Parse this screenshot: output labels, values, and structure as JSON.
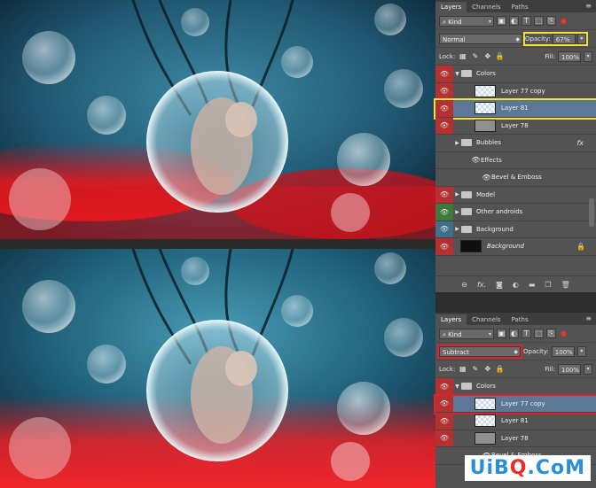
{
  "panel_top": {
    "tabs": [
      "Layers",
      "Channels",
      "Paths"
    ],
    "kind_label": "Kind",
    "blend_mode": "Normal",
    "opacity_label": "Opacity:",
    "opacity_value": "67%",
    "lock_label": "Lock:",
    "fill_label": "Fill:",
    "fill_value": "100%",
    "layers": [
      {
        "name": "Colors",
        "type": "group-open",
        "eye": "red"
      },
      {
        "name": "Layer 77 copy",
        "type": "layer",
        "eye": "red"
      },
      {
        "name": "Layer 81",
        "type": "layer",
        "eye": "red",
        "selected": true
      },
      {
        "name": "Layer 78",
        "type": "layer",
        "eye": "red"
      },
      {
        "name": "Bubbles",
        "type": "group",
        "eye": "none"
      },
      {
        "name": "Effects",
        "type": "effects",
        "eye": "none"
      },
      {
        "name": "Bevel & Emboss",
        "type": "effect",
        "eye": "none"
      },
      {
        "name": "Model",
        "type": "group",
        "eye": "red"
      },
      {
        "name": "Other androids",
        "type": "group",
        "eye": "green"
      },
      {
        "name": "Background",
        "type": "group",
        "eye": "blue"
      },
      {
        "name": "Background",
        "type": "bg",
        "eye": "red"
      }
    ]
  },
  "panel_bottom": {
    "tabs": [
      "Layers",
      "Channels",
      "Paths"
    ],
    "kind_label": "Kind",
    "blend_mode": "Subtract",
    "opacity_label": "Opacity:",
    "opacity_value": "100%",
    "lock_label": "Lock:",
    "fill_label": "Fill:",
    "fill_value": "100%",
    "layers": [
      {
        "name": "Colors",
        "type": "group-open",
        "eye": "red"
      },
      {
        "name": "Layer 77 copy",
        "type": "layer",
        "eye": "red",
        "selected": true
      },
      {
        "name": "Layer 81",
        "type": "layer",
        "eye": "red"
      },
      {
        "name": "Layer 78",
        "type": "layer",
        "eye": "red"
      },
      {
        "name": "Bevel & Emboss",
        "type": "effect",
        "eye": "none"
      }
    ]
  },
  "watermark": {
    "part1": "UiB",
    "part2": "Q",
    "part3": ".CoM"
  },
  "colors": {
    "highlight_yellow": "#f2e23a",
    "highlight_red": "#e0202a",
    "selected_row": "#5c7896"
  }
}
